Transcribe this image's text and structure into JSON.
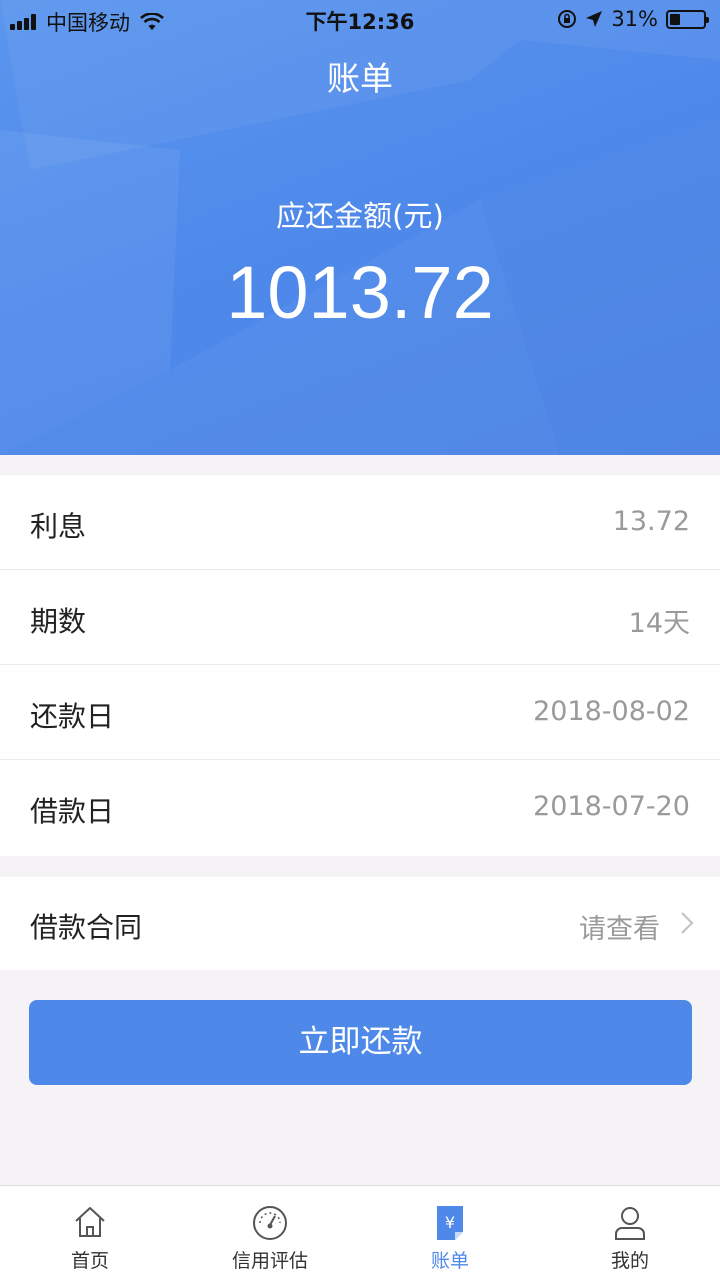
{
  "status_bar": {
    "carrier": "中国移动",
    "time": "下午12:36",
    "battery_percent": "31%"
  },
  "header": {
    "title": "账单"
  },
  "summary": {
    "label": "应还金额(元)",
    "amount": "1013.72"
  },
  "details": [
    {
      "label": "利息",
      "value": "13.72"
    },
    {
      "label": "期数",
      "value": "14天"
    },
    {
      "label": "还款日",
      "value": "2018-08-02"
    },
    {
      "label": "借款日",
      "value": "2018-07-20"
    }
  ],
  "contract": {
    "label": "借款合同",
    "action": "请查看"
  },
  "pay_button": {
    "label": "立即还款"
  },
  "tabbar": {
    "items": [
      {
        "label": "首页",
        "icon": "home-icon",
        "active": false
      },
      {
        "label": "信用评估",
        "icon": "gauge-icon",
        "active": false
      },
      {
        "label": "账单",
        "icon": "bill-icon",
        "active": true
      },
      {
        "label": "我的",
        "icon": "user-icon",
        "active": false
      }
    ]
  },
  "colors": {
    "primary": "#4e89ea",
    "background": "#f6f3f6",
    "secondary_text": "#9a9a9a"
  }
}
